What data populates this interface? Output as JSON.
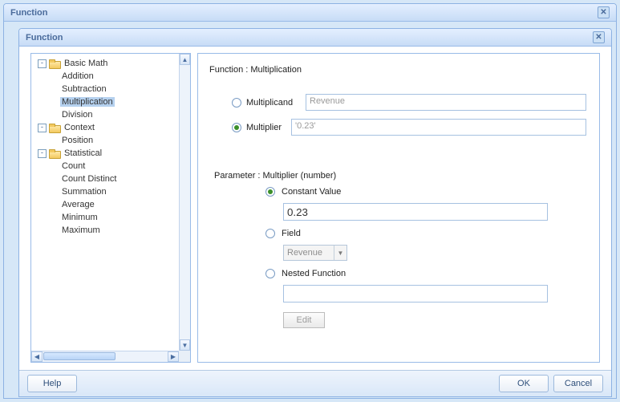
{
  "outer": {
    "title": "Function"
  },
  "inner": {
    "title": "Function"
  },
  "tree": {
    "basic_math": {
      "label": "Basic Math",
      "addition": "Addition",
      "subtraction": "Subtraction",
      "multiplication": "Multiplication",
      "division": "Division"
    },
    "context": {
      "label": "Context",
      "position": "Position"
    },
    "statistical": {
      "label": "Statistical",
      "count": "Count",
      "count_distinct": "Count Distinct",
      "summation": "Summation",
      "average": "Average",
      "minimum": "Minimum",
      "maximum": "Maximum"
    }
  },
  "details": {
    "title": "Function : Multiplication",
    "multiplicand_label": "Multiplicand",
    "multiplicand_value": "Revenue",
    "multiplier_label": "Multiplier",
    "multiplier_value": "'0.23'",
    "param_header": "Parameter : Multiplier (number)",
    "opt_constant": "Constant Value",
    "constant_value": "0.23",
    "opt_field": "Field",
    "field_combo": "Revenue",
    "opt_nested": "Nested Function",
    "nested_value": "",
    "edit_label": "Edit"
  },
  "buttons": {
    "help": "Help",
    "ok": "OK",
    "cancel": "Cancel"
  }
}
